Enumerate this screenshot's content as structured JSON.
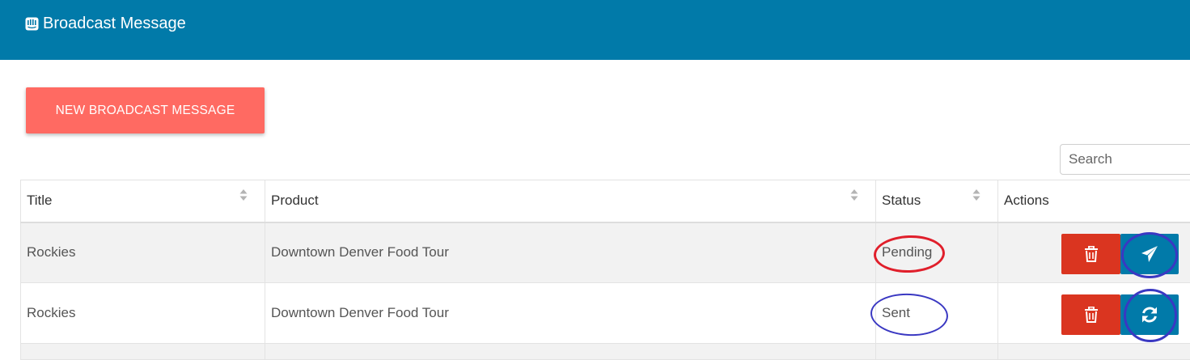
{
  "header": {
    "title": "Broadcast Message",
    "icon": "broadcast-icon"
  },
  "toolbar": {
    "new_button_label": "NEW BROADCAST MESSAGE"
  },
  "search": {
    "placeholder": "Search",
    "value": ""
  },
  "table": {
    "columns": [
      "Title",
      "Product",
      "Status",
      "Actions"
    ],
    "rows": [
      {
        "title": "Rockies",
        "product": "Downtown Denver Food Tour",
        "status": "Pending",
        "action_icon": "send-icon"
      },
      {
        "title": "Rockies",
        "product": "Downtown Denver Food Tour",
        "status": "Sent",
        "action_icon": "refresh-icon"
      }
    ]
  },
  "colors": {
    "header_bg": "#017aa9",
    "new_button": "#ff6a62",
    "delete_button": "#da3520",
    "action_button": "#017aa9",
    "annotation_red": "#e01f2b",
    "annotation_blue": "#3a38c2"
  }
}
